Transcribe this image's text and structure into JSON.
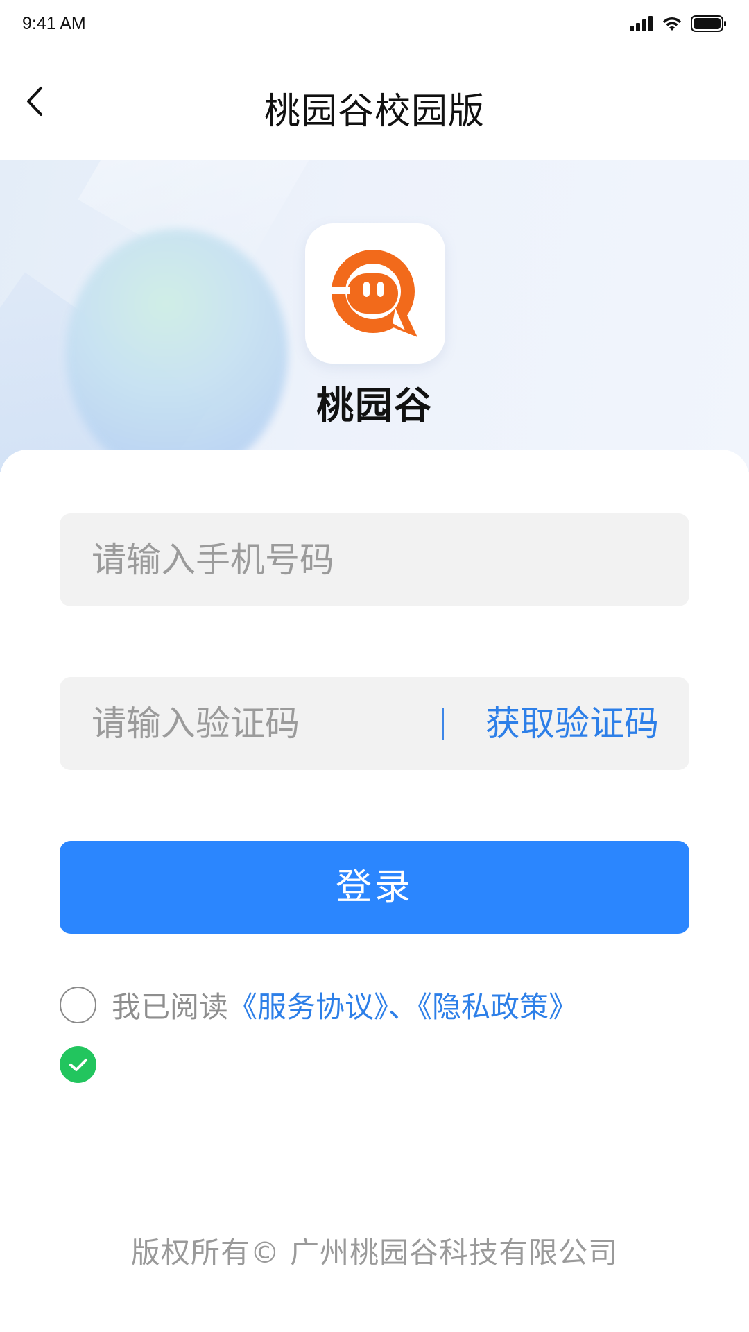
{
  "status_bar": {
    "time": "9:41 AM",
    "icons": [
      "signal-icon",
      "wifi-icon",
      "battery-icon"
    ]
  },
  "nav": {
    "back_icon": "chevron-left-icon",
    "title": "桃园谷校园版"
  },
  "hero": {
    "app_name": "桃园谷",
    "logo_icon": "app-logo-icon"
  },
  "form": {
    "phone_placeholder": "请输入手机号码",
    "phone_value": "",
    "code_placeholder": "请输入验证码",
    "code_value": "",
    "get_code_label": "获取验证码",
    "login_label": "登录"
  },
  "agreement": {
    "prefix": "我已阅读",
    "service_link": "《服务协议》",
    "separator": "、",
    "privacy_link": "《隐私政策》",
    "checked": false
  },
  "footer": {
    "copyright": "版权所有© 广州桃园谷科技有限公司"
  },
  "colors": {
    "primary": "#2B86FE",
    "link": "#2D7FE8",
    "logo_orange": "#F26A1B",
    "check_green": "#22C55E",
    "input_bg": "#F2F2F2"
  }
}
